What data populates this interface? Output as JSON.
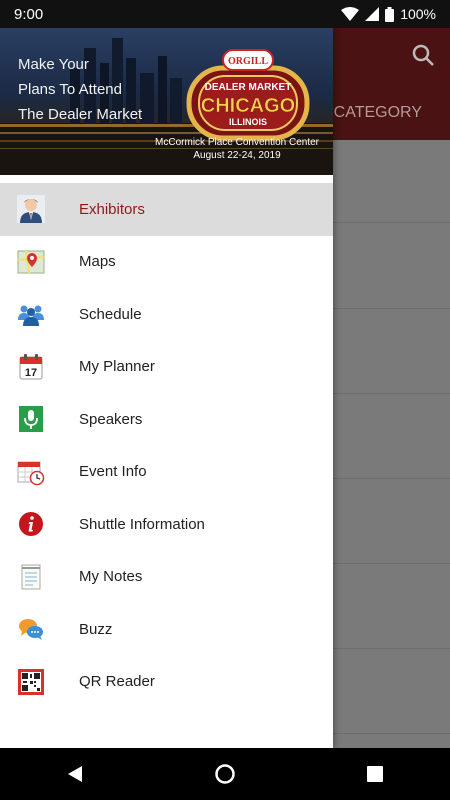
{
  "status_bar": {
    "time": "9:00",
    "battery": "100%",
    "icons": [
      "wifi-icon",
      "signal-icon",
      "battery-icon"
    ]
  },
  "background_app": {
    "tab_label": "T CATEGORY",
    "toolbar_color": "#4a1212"
  },
  "banner": {
    "tagline_lines": [
      "Make Your",
      "Plans To Attend",
      "The Dealer Market"
    ],
    "logo_brand": "ORGILL",
    "logo_top": "DEALER MARKET",
    "logo_city": "CHICAGO",
    "logo_state": "ILLINOIS",
    "venue": "McCormick Place Convention Center",
    "dates": "August 22-24, 2019"
  },
  "menu": {
    "items": [
      {
        "label": "Exhibitors",
        "icon": "exhibitor-person-icon",
        "active": true
      },
      {
        "label": "Maps",
        "icon": "map-pin-icon",
        "active": false
      },
      {
        "label": "Schedule",
        "icon": "group-people-icon",
        "active": false
      },
      {
        "label": "My Planner",
        "icon": "calendar-icon",
        "active": false
      },
      {
        "label": "Speakers",
        "icon": "microphone-icon",
        "active": false
      },
      {
        "label": "Event Info",
        "icon": "calendar-clock-icon",
        "active": false
      },
      {
        "label": "Shuttle Information",
        "icon": "info-icon",
        "active": false
      },
      {
        "label": "My Notes",
        "icon": "notepad-icon",
        "active": false
      },
      {
        "label": "Buzz",
        "icon": "chat-bubbles-icon",
        "active": false
      },
      {
        "label": "QR Reader",
        "icon": "qr-code-icon",
        "active": false
      }
    ]
  },
  "colors": {
    "active_label": "#8b1a1a",
    "active_bg": "#dcdcdc"
  }
}
